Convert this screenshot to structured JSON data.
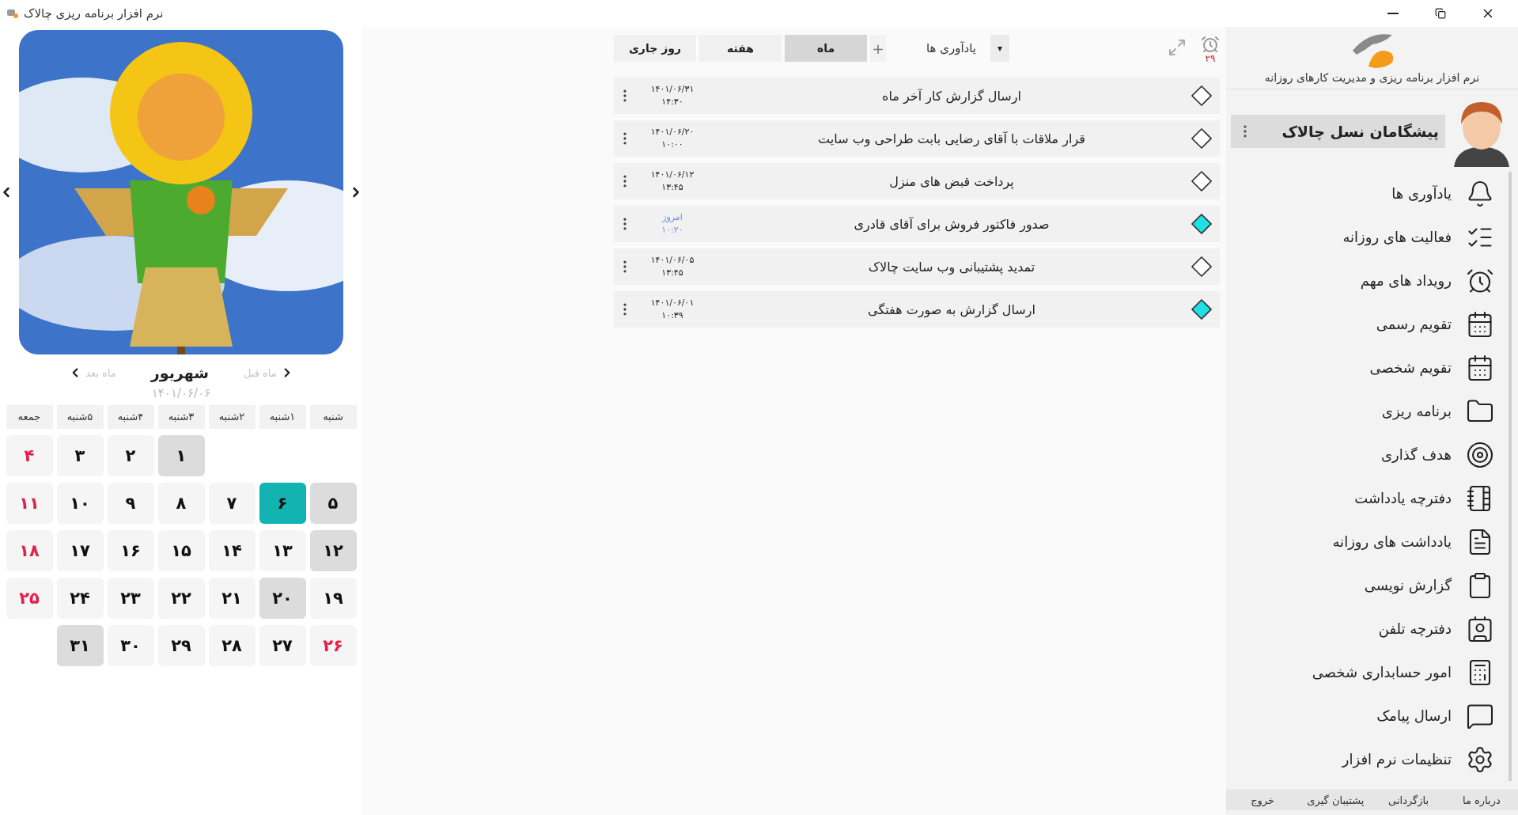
{
  "window": {
    "title": "نرم افزار برنامه ریزی چالاک"
  },
  "calendar": {
    "prev_label": "ماه قبل",
    "next_label": "ماه بعد",
    "month": "شهریور",
    "date": "۱۴۰۱/۰۶/۰۶",
    "weekdays": [
      "شنبه",
      "۱شنبه",
      "۲شنبه",
      "۳شنبه",
      "۴شنبه",
      "۵شنبه",
      "جمعه"
    ],
    "weeks": [
      [
        {
          "kind": "empty"
        },
        {
          "kind": "empty"
        },
        {
          "kind": "empty"
        },
        {
          "day": "۱",
          "kind": "event",
          "holiday": false
        },
        {
          "day": "۲",
          "kind": "normal",
          "holiday": false
        },
        {
          "day": "۳",
          "kind": "normal",
          "holiday": false
        },
        {
          "day": "۴",
          "kind": "normal",
          "holiday": true
        }
      ],
      [
        {
          "day": "۵",
          "kind": "event",
          "holiday": false
        },
        {
          "day": "۶",
          "kind": "today",
          "holiday": false
        },
        {
          "day": "۷",
          "kind": "normal",
          "holiday": false
        },
        {
          "day": "۸",
          "kind": "normal",
          "holiday": false
        },
        {
          "day": "۹",
          "kind": "normal",
          "holiday": false
        },
        {
          "day": "۱۰",
          "kind": "normal",
          "holiday": false
        },
        {
          "day": "۱۱",
          "kind": "normal",
          "holiday": true
        }
      ],
      [
        {
          "day": "۱۲",
          "kind": "event",
          "holiday": false
        },
        {
          "day": "۱۳",
          "kind": "normal",
          "holiday": false
        },
        {
          "day": "۱۴",
          "kind": "normal",
          "holiday": false
        },
        {
          "day": "۱۵",
          "kind": "normal",
          "holiday": false
        },
        {
          "day": "۱۶",
          "kind": "normal",
          "holiday": false
        },
        {
          "day": "۱۷",
          "kind": "normal",
          "holiday": false
        },
        {
          "day": "۱۸",
          "kind": "normal",
          "holiday": true
        }
      ],
      [
        {
          "day": "۱۹",
          "kind": "normal",
          "holiday": false
        },
        {
          "day": "۲۰",
          "kind": "event",
          "holiday": false
        },
        {
          "day": "۲۱",
          "kind": "normal",
          "holiday": false
        },
        {
          "day": "۲۲",
          "kind": "normal",
          "holiday": false
        },
        {
          "day": "۲۳",
          "kind": "normal",
          "holiday": false
        },
        {
          "day": "۲۴",
          "kind": "normal",
          "holiday": false
        },
        {
          "day": "۲۵",
          "kind": "normal",
          "holiday": true
        }
      ],
      [
        {
          "day": "۲۶",
          "kind": "normal",
          "holiday": true
        },
        {
          "day": "۲۷",
          "kind": "normal",
          "holiday": false
        },
        {
          "day": "۲۸",
          "kind": "normal",
          "holiday": false
        },
        {
          "day": "۲۹",
          "kind": "normal",
          "holiday": false
        },
        {
          "day": "۳۰",
          "kind": "normal",
          "holiday": false
        },
        {
          "day": "۳۱",
          "kind": "event",
          "holiday": false
        },
        {
          "kind": "empty"
        }
      ]
    ]
  },
  "toolbar": {
    "alarm_count": "۲۹",
    "dropdown": "▾",
    "view_label": "یادآوری ها",
    "add": "+",
    "tabs": [
      {
        "label": "ماه",
        "selected": true
      },
      {
        "label": "هفته",
        "selected": false
      },
      {
        "label": "روز جاری",
        "selected": false
      }
    ]
  },
  "reminders": [
    {
      "title": "ارسال گزارش کار آخر ماه",
      "date": "۱۴۰۱/۰۶/۳۱",
      "time": "۱۴:۳۰",
      "today": false,
      "done": false
    },
    {
      "title": "قرار ملاقات با آقای رضایی بابت طراحی وب سایت",
      "date": "۱۴۰۱/۰۶/۲۰",
      "time": "۱۰:۰۰",
      "today": false,
      "done": false
    },
    {
      "title": "پرداخت قبض های منزل",
      "date": "۱۴۰۱/۰۶/۱۲",
      "time": "۱۳:۴۵",
      "today": false,
      "done": false
    },
    {
      "title": "صدور فاکتور فروش برای آقای قادری",
      "date": "امروز",
      "time": "۱۰:۲۰",
      "today": true,
      "done": true
    },
    {
      "title": "تمدید پشتیبانی وب سایت چالاک",
      "date": "۱۴۰۱/۰۶/۰۵",
      "time": "۱۳:۴۵",
      "today": false,
      "done": false
    },
    {
      "title": "ارسال گزارش به صورت هفتگی",
      "date": "۱۴۰۱/۰۶/۰۱",
      "time": "۱۰:۳۹",
      "today": false,
      "done": true
    }
  ],
  "sidebar": {
    "tagline": "نرم افزار برنامه ریزی و مدیریت کارهای روزانه",
    "user": "پیشگامان نسل چالاک",
    "items": [
      "یادآوری ها",
      "فعالیت های روزانه",
      "رویداد های مهم",
      "تقویم رسمی",
      "تقویم شخصی",
      "برنامه ریزی",
      "هدف گذاری",
      "دفترچه یادداشت",
      "یادداشت های روزانه",
      "گزارش نویسی",
      "دفترچه تلفن",
      "امور حسابداری شخصی",
      "ارسال پیامک",
      "تنظیمات نرم افزار"
    ],
    "footer": [
      "درباره ما",
      "بازگردانی",
      "پشتیبان گیری",
      "خروج"
    ]
  }
}
